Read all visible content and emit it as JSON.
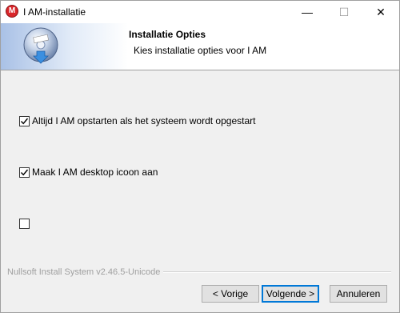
{
  "window": {
    "title": "I AM-installatie",
    "icon_letter": "M",
    "controls": {
      "minimize": "—",
      "maximize": "☐",
      "close": "✕"
    }
  },
  "header": {
    "title": "Installatie Opties",
    "subtitle": "Kies installatie opties voor I AM"
  },
  "options": [
    {
      "label": "Altijd I AM opstarten als het systeem wordt opgestart",
      "checked": true
    },
    {
      "label": "Maak I AM desktop icoon aan",
      "checked": true
    },
    {
      "label": "",
      "checked": false
    }
  ],
  "branding": "Nullsoft Install System v2.46.5-Unicode",
  "buttons": {
    "back": "< Vorige",
    "next": "Volgende >",
    "cancel": "Annuleren"
  },
  "colors": {
    "accent": "#0078d7",
    "icon_red": "#d9262a"
  }
}
